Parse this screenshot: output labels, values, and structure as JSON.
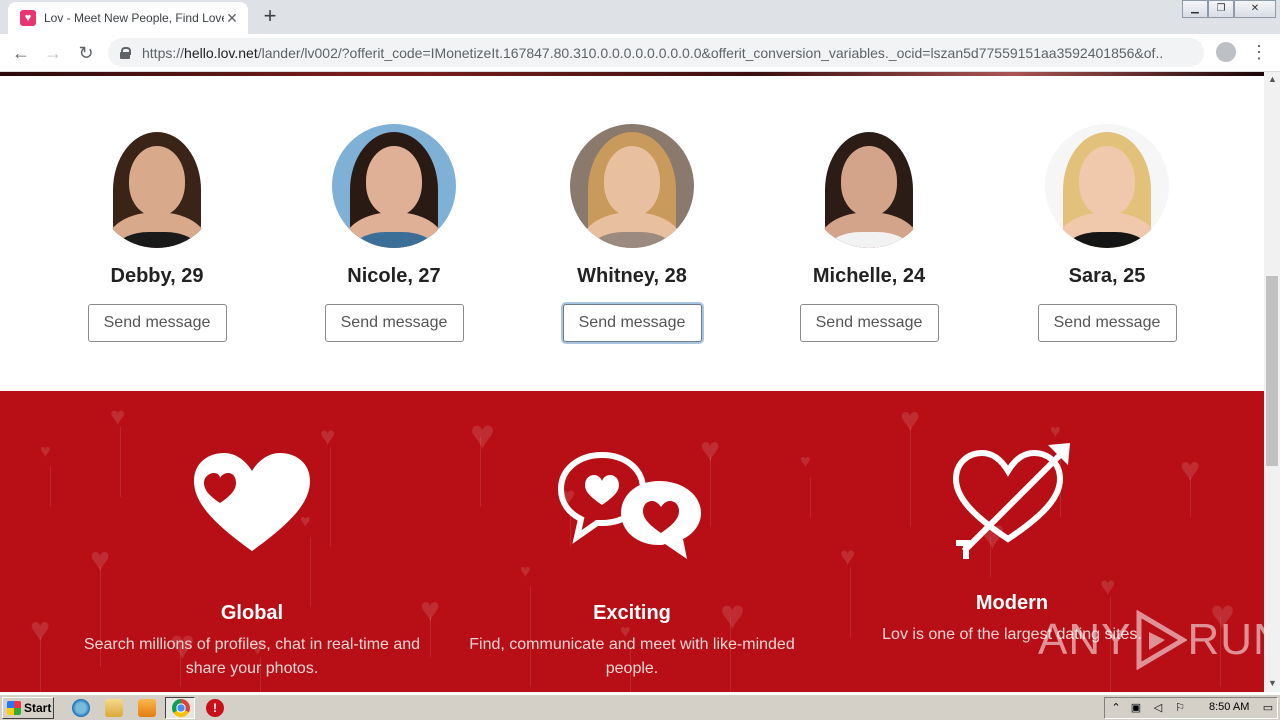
{
  "browser": {
    "tab_title": "Lov - Meet New People, Find Love, C",
    "favicon_glyph": "♥",
    "close_glyph": "✕",
    "new_tab_glyph": "+",
    "url_scheme": "https://",
    "url_host": "hello.lov.net",
    "url_rest": "/lander/lv002/?offerit_code=IMonetizeIt.167847.80.310.0.0.0.0.0.0.0.0.0&offerit_conversion_variables._ocid=lszan5d77559151aa3592401856&of...",
    "back_glyph": "←",
    "forward_glyph": "→",
    "reload_glyph": "↻",
    "star_glyph": "☆",
    "menu_glyph": "⋮",
    "window_buttons": [
      "▁",
      "❐",
      "✕"
    ]
  },
  "profiles": [
    {
      "name": "Debby, 29",
      "button": "Send message",
      "hair": "#3a2418",
      "skin": "#d9a98c",
      "top": "#1a1a1a",
      "bg": "#ffffff"
    },
    {
      "name": "Nicole, 27",
      "button": "Send message",
      "hair": "#2a1a14",
      "skin": "#e0b096",
      "top": "#3c6f98",
      "bg": "#7fb0d6"
    },
    {
      "name": "Whitney, 28",
      "button": "Send message",
      "hair": "#c89a5c",
      "skin": "#e8c0a0",
      "top": "#9a8a80",
      "bg": "#8a7a6e"
    },
    {
      "name": "Michelle, 24",
      "button": "Send message",
      "hair": "#2b1d16",
      "skin": "#d4a48a",
      "top": "#f2f2f2",
      "bg": "#ffffff"
    },
    {
      "name": "Sara, 25",
      "button": "Send message",
      "hair": "#e2c27a",
      "skin": "#f0c9ac",
      "top": "#151515",
      "bg": "#f6f6f6"
    }
  ],
  "features": [
    {
      "title": "Global",
      "desc": "Search millions of profiles, chat in real-time and share your photos.",
      "icon": "heart-icon"
    },
    {
      "title": "Exciting",
      "desc": "Find, communicate and meet with like-minded people.",
      "icon": "chat-hearts-icon"
    },
    {
      "title": "Modern",
      "desc": "Lov is one of the largest dating sites.",
      "icon": "heart-arrow-icon"
    }
  ],
  "colors": {
    "feature_bg": "#b70f15",
    "focus_ring": "#a9c4de"
  },
  "watermark": {
    "left": "ANY",
    "right": "RUN"
  },
  "taskbar": {
    "start_label": "Start",
    "clock": "8:50 AM",
    "stop_glyph": "!"
  }
}
